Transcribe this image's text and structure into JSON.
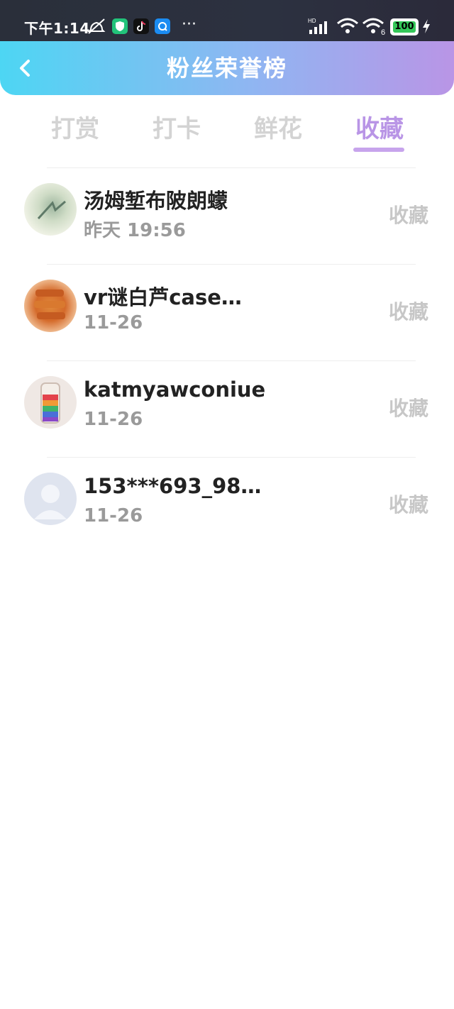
{
  "status_bar": {
    "time": "下午1:14",
    "more": "···",
    "battery": "100"
  },
  "header": {
    "title": "粉丝荣誉榜"
  },
  "tabs": [
    {
      "label": "打赏"
    },
    {
      "label": "打卡"
    },
    {
      "label": "鲜花"
    },
    {
      "label": "收藏"
    }
  ],
  "list": [
    {
      "name": "汤姆堑布陂朗蠓",
      "time": "昨天 19:56",
      "action": "收藏"
    },
    {
      "name": "vr谜白芦case…",
      "time": "11-26",
      "action": "收藏"
    },
    {
      "name": "katmyawconiue",
      "time": "11-26",
      "action": "收藏"
    },
    {
      "name": "153***693_98…",
      "time": "11-26",
      "action": "收藏"
    }
  ],
  "colors": {
    "accent": "#b995e6",
    "header_left": "#4dd6f3",
    "header_right": "#b995e6",
    "muted": "#9a9a9a",
    "tab_inactive": "#d3d3d3"
  }
}
